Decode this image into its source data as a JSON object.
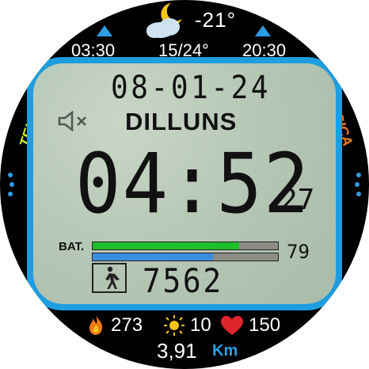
{
  "weather": {
    "icon": "moon-cloud-icon",
    "temperature": "-21°"
  },
  "sun": {
    "sunrise_time": "03:30",
    "temperature_range": "15/24°",
    "sunset_time": "20:30"
  },
  "complications": {
    "left_label": "TELF.",
    "right_label": "MUSICA"
  },
  "lcd": {
    "date": "08-01-24",
    "day_name": "DILLUNS",
    "mute_icon": "speaker-muted-icon",
    "time": "04:52",
    "seconds": "27",
    "battery": {
      "label": "BAT.",
      "percent": "79",
      "level": 0.79
    },
    "secondary_bar_level": 0.65,
    "steps": "7562",
    "steps_icon": "walking-person-icon"
  },
  "stats": {
    "calories": "273",
    "uv_index": "10",
    "heart_rate": "150",
    "distance": "3,91",
    "distance_unit": "Km"
  },
  "colors": {
    "accent_blue": "#1e9ddf",
    "lcd_background": "#b9c9b8",
    "battery_green": "#1fbf2a",
    "steps_blue": "#3a8ee0",
    "telf_yellow": "#d7ea1e",
    "musica_orange": "#f07a18",
    "heart_red": "#e0242b",
    "sun_yellow": "#f5c518",
    "flame_orange": "#f07a18"
  }
}
